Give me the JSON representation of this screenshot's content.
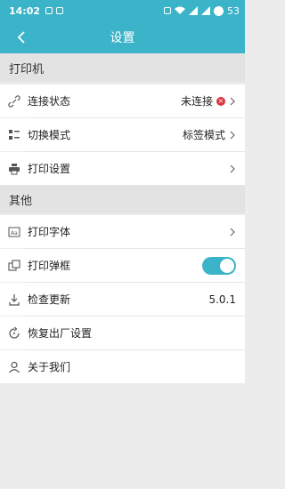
{
  "status_bar": {
    "time": "14:02",
    "battery": "53"
  },
  "header": {
    "title": "设置"
  },
  "sections": {
    "printer": {
      "title": "打印机",
      "items": [
        {
          "label": "连接状态",
          "value": "未连接"
        },
        {
          "label": "切换模式",
          "value": "标签模式"
        },
        {
          "label": "打印设置"
        }
      ]
    },
    "other": {
      "title": "其他",
      "items": [
        {
          "label": "打印字体"
        },
        {
          "label": "打印弹框",
          "toggle_on": true
        },
        {
          "label": "检查更新",
          "value": "5.0.1"
        },
        {
          "label": "恢复出厂设置"
        },
        {
          "label": "关于我们"
        }
      ]
    }
  },
  "colors": {
    "accent": "#3bb3c8",
    "error": "#d9363e"
  }
}
